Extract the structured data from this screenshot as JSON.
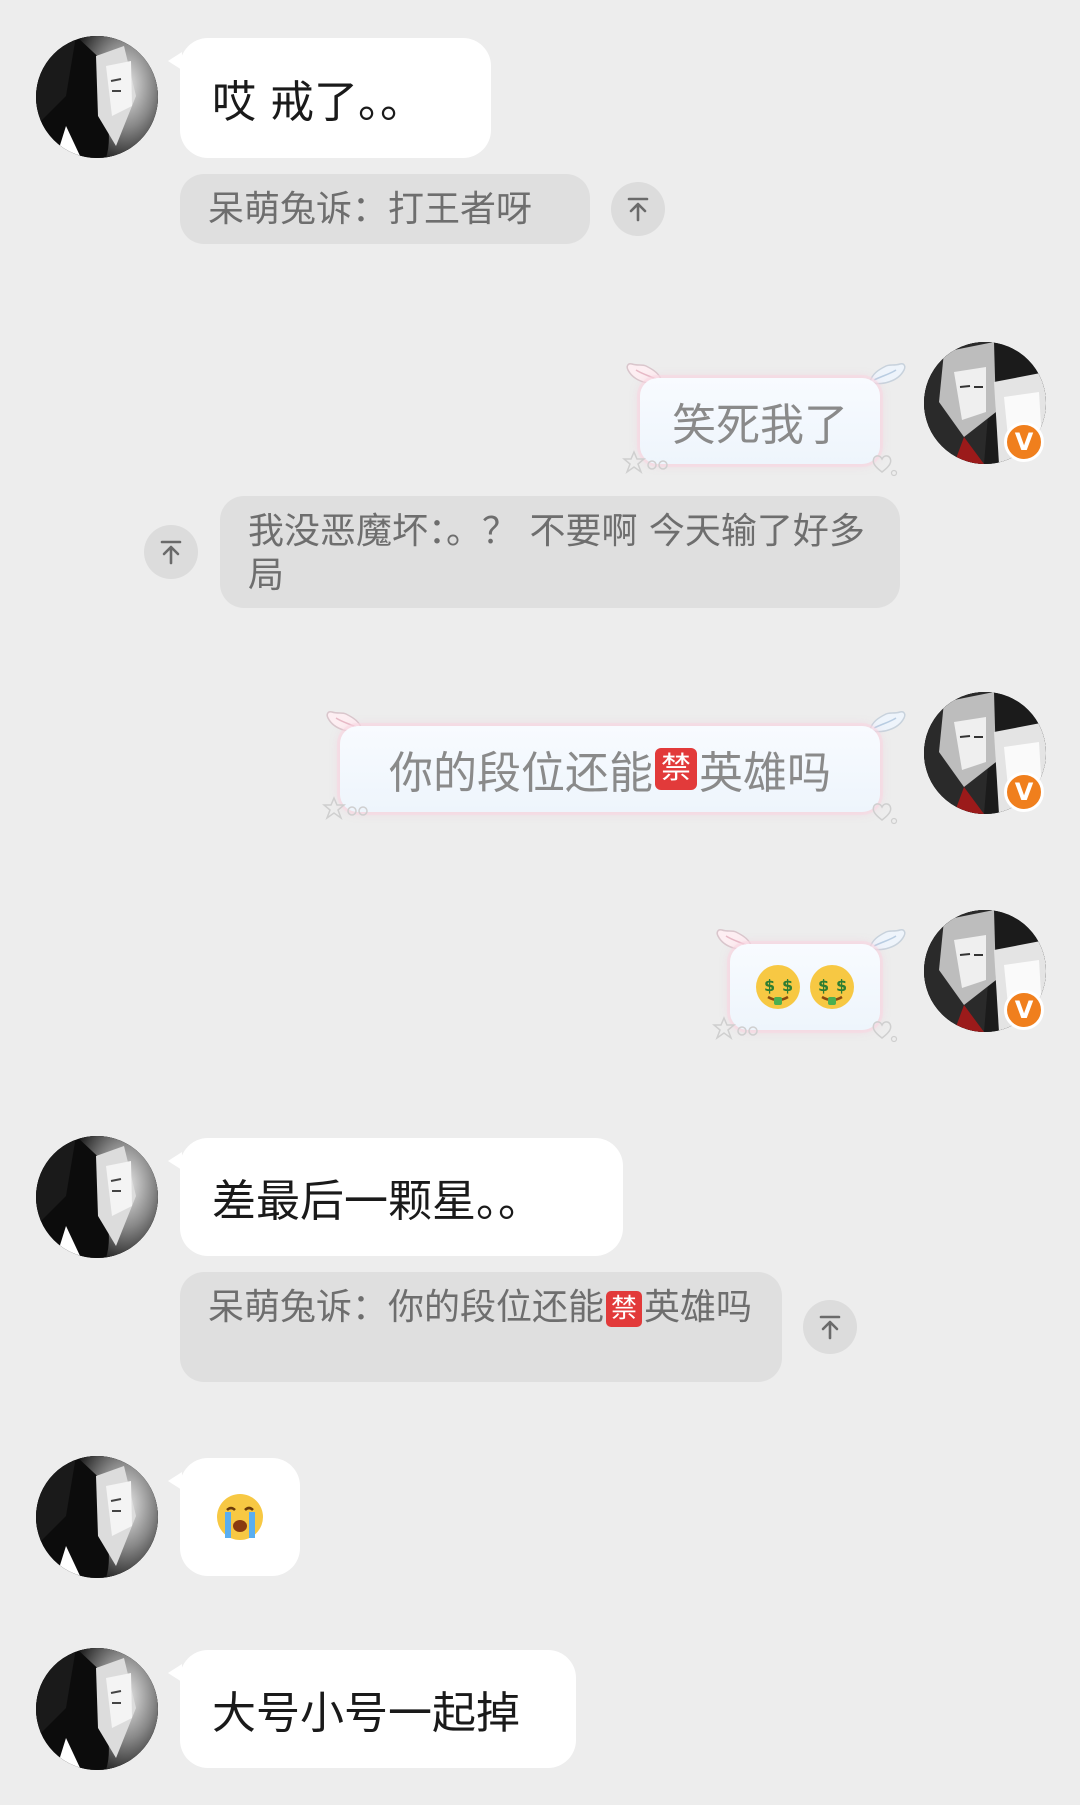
{
  "messages": [
    {
      "text": "哎 戒了。。"
    },
    {
      "quote": "呆萌兔诉：打王者呀"
    },
    {
      "text": "笑死我了"
    },
    {
      "quote": "我没恶魔坏：。？ 不要啊 今天输了好多局"
    },
    {
      "text_before": "你的段位还能",
      "ban": "禁",
      "text_after": "英雄吗"
    },
    {
      "emoji": "money-mouth-face-emoji money-mouth-face-emoji"
    },
    {
      "text": "差最后一颗星。。"
    },
    {
      "quote_before": "呆萌兔诉：你的段位还能",
      "ban": "禁",
      "quote_after": "英雄吗"
    },
    {
      "emoji": "loudly-crying-face-emoji"
    },
    {
      "text": "大号小号一起掉"
    }
  ],
  "badge": "V",
  "colors": {
    "background": "#ededed",
    "badge": "#f07f1d",
    "quote_bg": "#dfdfdf"
  }
}
